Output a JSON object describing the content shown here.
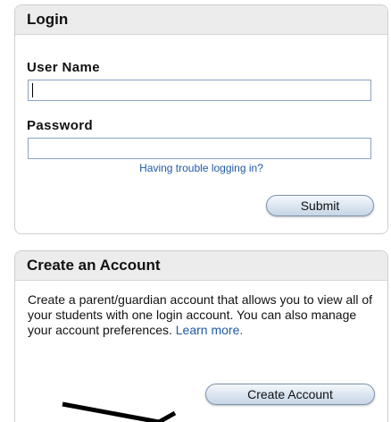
{
  "login": {
    "title": "Login",
    "username_label": "User Name",
    "username_value": "",
    "password_label": "Password",
    "password_value": "",
    "trouble_link": "Having trouble logging in?",
    "submit_label": "Submit"
  },
  "create_account": {
    "title": "Create an Account",
    "description": "Create a parent/guardian account that allows you to view all of your students with one login account. You can also manage your account preferences.",
    "learn_more": "Learn more.",
    "button_label": "Create Account"
  },
  "colors": {
    "link": "#1f5aa6",
    "header_bg": "#ececec",
    "input_border": "#8aa3c4",
    "button_border": "#7c93ad"
  }
}
